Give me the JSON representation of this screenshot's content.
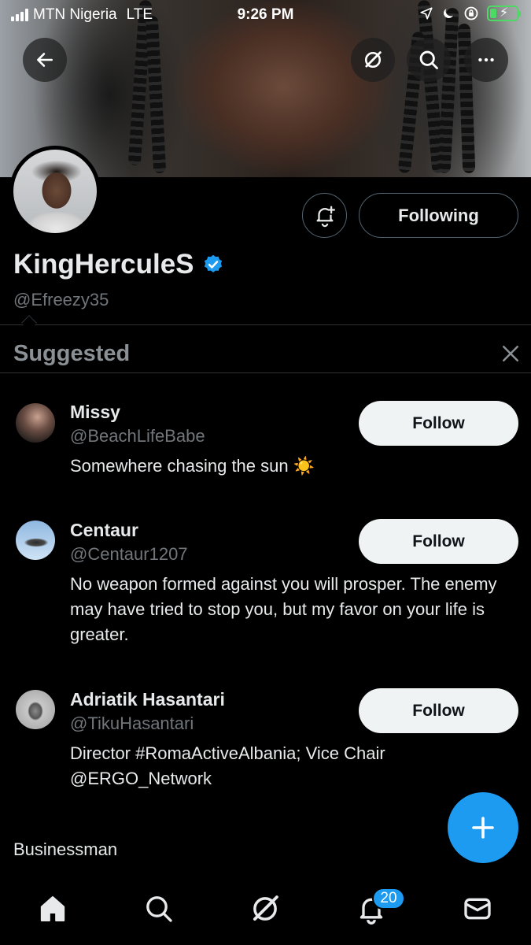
{
  "status_bar": {
    "carrier": "MTN Nigeria",
    "network": "LTE",
    "time": "9:26 PM"
  },
  "header": {
    "icons": [
      "back-arrow-icon",
      "grok-icon",
      "search-icon",
      "more-icon"
    ]
  },
  "profile": {
    "display_name": "KingHerculeS",
    "handle": "@Efreezy35",
    "verified": true,
    "following_label": "Following",
    "bio": "Businessman"
  },
  "suggested": {
    "title": "Suggested",
    "items": [
      {
        "name": "Missy",
        "handle": "@BeachLifeBabe",
        "bio": "Somewhere chasing the sun ☀️",
        "follow_label": "Follow"
      },
      {
        "name": "Centaur",
        "handle": "@Centaur1207",
        "bio": "No weapon formed against you will prosper. The enemy may have tried to stop you, but my favor on your life is greater.",
        "follow_label": "Follow"
      },
      {
        "name": "Adriatik Hasantari",
        "handle": "@TikuHasantari",
        "bio": "Director #RomaActiveAlbania; Vice Chair @ERGO_Network",
        "follow_label": "Follow"
      }
    ]
  },
  "tab_bar": {
    "tabs": [
      "home-icon",
      "search-icon",
      "grok-icon",
      "notifications-icon",
      "messages-icon"
    ],
    "notification_count": "20"
  },
  "colors": {
    "accent": "#1d9bf0",
    "background": "#000000",
    "muted_text": "#71767b"
  }
}
